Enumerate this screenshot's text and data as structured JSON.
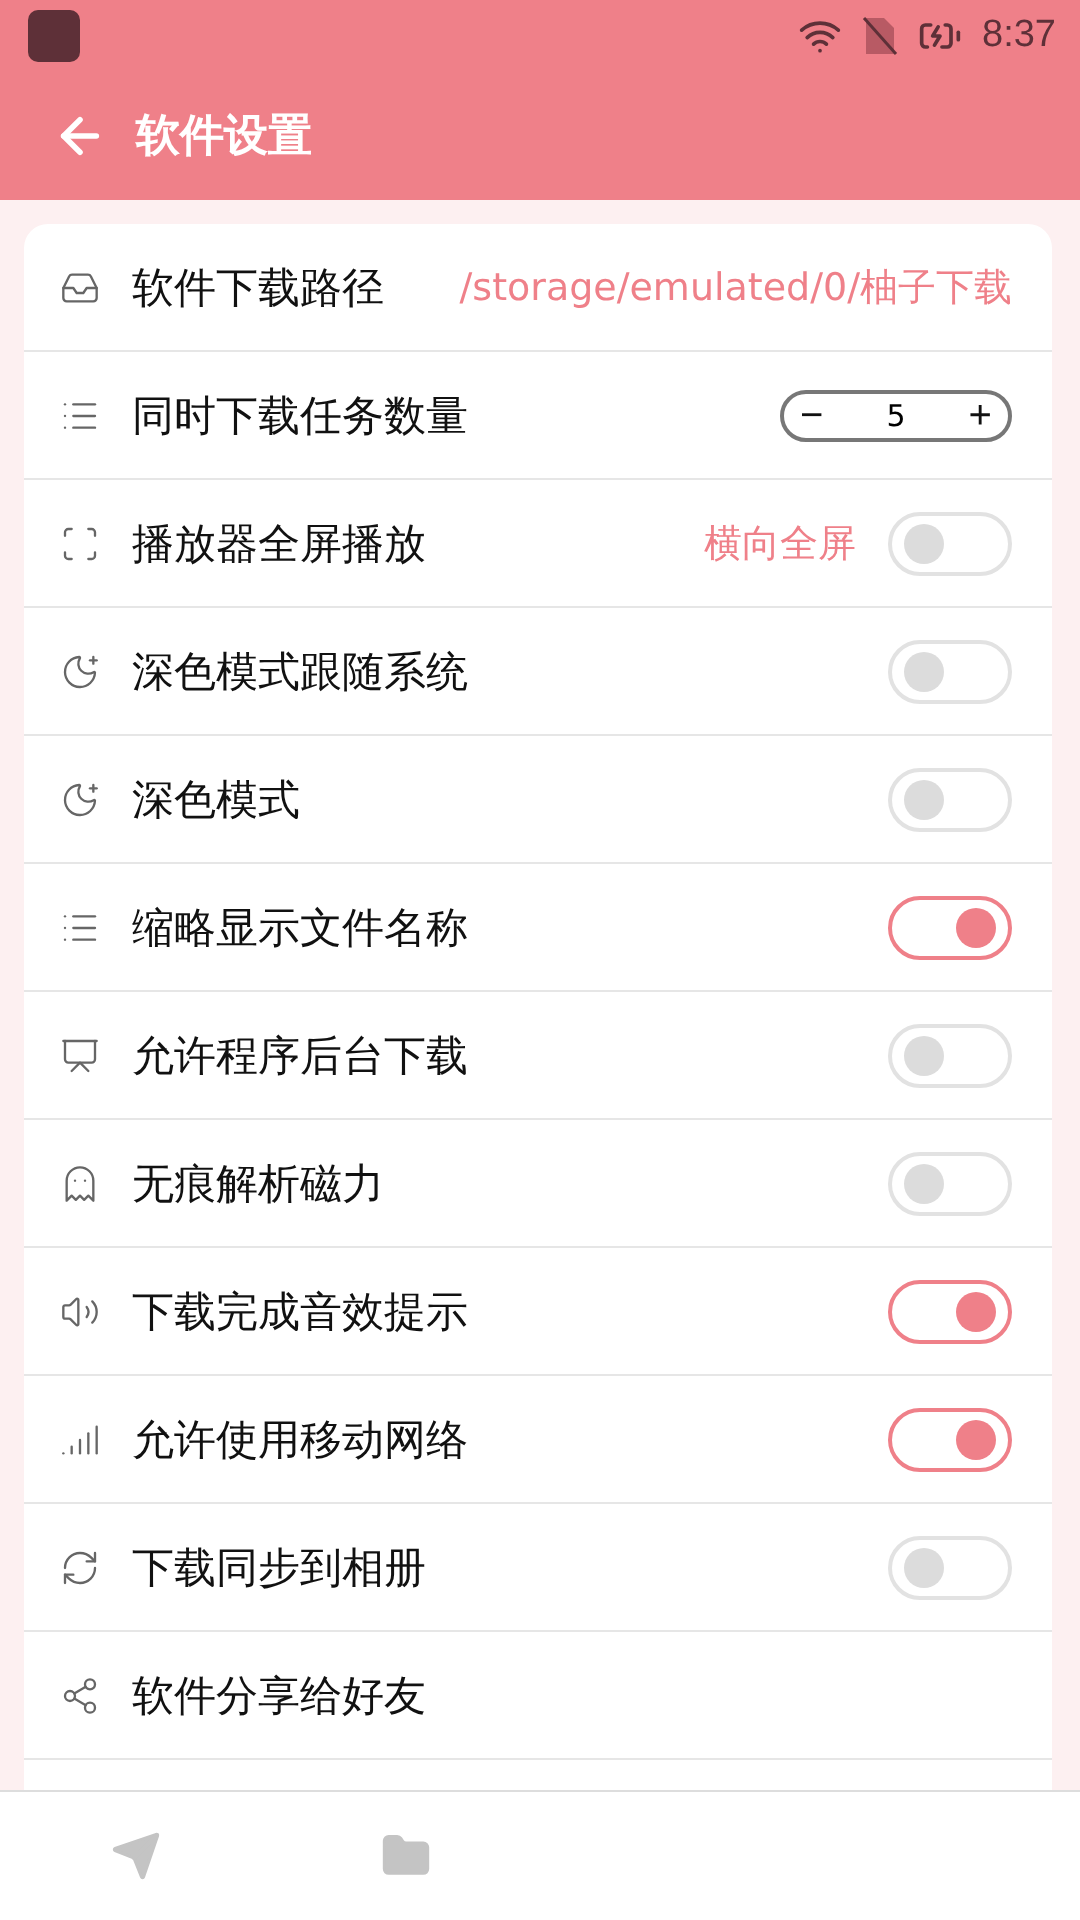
{
  "status_bar": {
    "time": "8:37"
  },
  "app_bar": {
    "title": "软件设置"
  },
  "settings": [
    {
      "kind": "path",
      "label": "软件下载路径",
      "value": "/storage/emulated/0/柚子下载"
    },
    {
      "kind": "stepper",
      "label": "同时下载任务数量",
      "minus": "−",
      "count": "5",
      "plus": "+"
    },
    {
      "kind": "toggle",
      "label": "播放器全屏播放",
      "value": "横向全屏",
      "on": false
    },
    {
      "kind": "toggle",
      "label": "深色模式跟随系统",
      "on": false
    },
    {
      "kind": "toggle",
      "label": "深色模式",
      "on": false
    },
    {
      "kind": "toggle",
      "label": "缩略显示文件名称",
      "on": true
    },
    {
      "kind": "toggle",
      "label": "允许程序后台下载",
      "on": false
    },
    {
      "kind": "toggle",
      "label": "无痕解析磁力",
      "on": false
    },
    {
      "kind": "toggle",
      "label": "下载完成音效提示",
      "on": true
    },
    {
      "kind": "toggle",
      "label": "允许使用移动网络",
      "on": true
    },
    {
      "kind": "toggle",
      "label": "下载同步到相册",
      "on": false
    },
    {
      "kind": "plain",
      "label": "软件分享给好友"
    }
  ]
}
